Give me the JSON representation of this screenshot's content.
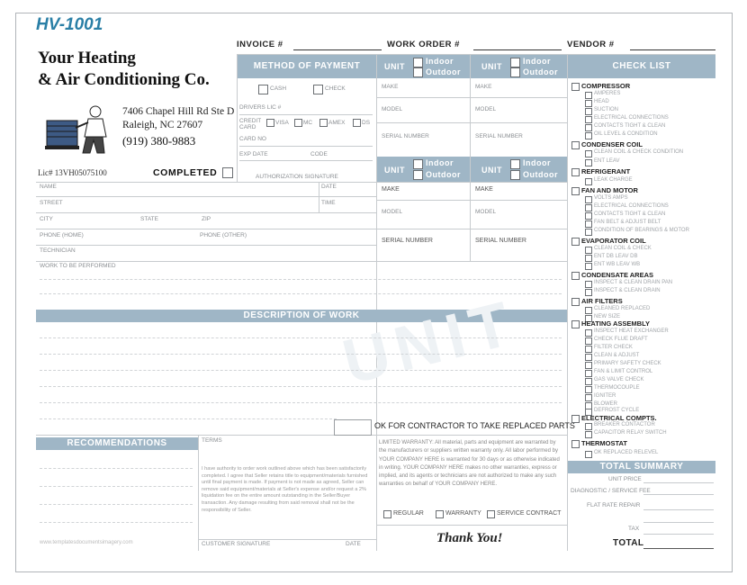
{
  "form_code": "HV-1001",
  "company": {
    "name_line1": "Your Heating",
    "name_line2": "& Air Conditioning Co.",
    "address_line1": "7406 Chapel Hill Rd Ste D",
    "address_line2": "Raleigh, NC 27607",
    "phone": "(919) 380-9883",
    "license": "Lic# 13VH05075100",
    "completed_label": "COMPLETED"
  },
  "top_fields": {
    "invoice": "INVOICE #",
    "work_order": "WORK ORDER #",
    "vendor": "VENDOR #"
  },
  "payment": {
    "header": "METHOD OF PAYMENT",
    "cash": "CASH",
    "check": "CHECK",
    "drivers_lic": "DRIVERS LIC #",
    "credit_card": "CREDIT CARD",
    "visa": "VISA",
    "mc": "MC",
    "amex": "AMEX",
    "ds": "DS",
    "card_no": "CARD NO",
    "exp_date": "EXP DATE",
    "code": "CODE",
    "auth_sig": "AUTHORIZATION SIGNATURE"
  },
  "unit": {
    "label": "UNIT",
    "indoor": "Indoor",
    "outdoor": "Outdoor",
    "make": "MAKE",
    "model": "MODEL",
    "serial": "SERIAL NUMBER"
  },
  "customer": {
    "name": "NAME",
    "date": "DATE",
    "street": "STREET",
    "time": "TIME",
    "city": "CITY",
    "state": "STATE",
    "zip": "ZIP",
    "phone_home": "PHONE (HOME)",
    "phone_other": "PHONE (OTHER)",
    "technician": "TECHNICIAN",
    "work_to_perform": "WORK TO BE PERFORMED"
  },
  "description_header": "DESCRIPTION OF WORK",
  "ok_contractor": "OK FOR CONTRACTOR TO TAKE REPLACED PARTS",
  "recommendations_header": "RECOMMENDATIONS",
  "terms": {
    "title": "TERMS",
    "body": "I have authority to order work outlined above which has been satisfactorily completed. I agree that Seller retains title to equipment/materials furnished until final payment is made. If payment is not made as agreed, Seller can remove said equipment/materials at Seller's expense and/or request a 2% liquidation fee on the entire amount outstanding in the Seller/Buyer transaction. Any damage resulting from said removal shall not be the responsibility of Seller.",
    "customer_sig": "CUSTOMER SIGNATURE",
    "date": "DATE"
  },
  "warranty": {
    "body": "LIMITED WARRANTY: All material, parts and equipment are warranted by the manufacturers or suppliers written warranty only. All labor performed by YOUR COMPANY HERE is warranted for 30 days or as otherwise indicated in writing. YOUR COMPANY HERE makes no other warranties, express or implied, and its agents or technicians are not authorized to make any such warranties on behalf of YOUR COMPANY HERE.",
    "regular": "REGULAR",
    "warranty": "WARRANTY",
    "service_contract": "SERVICE CONTRACT",
    "thank_you": "Thank You!"
  },
  "checklist": {
    "header": "CHECK LIST",
    "sections": [
      {
        "title": "COMPRESSOR",
        "items": [
          "AMPERES",
          "HEAD",
          "SUCTION",
          "ELECTRICAL CONNECTIONS",
          "CONTACTS TIGHT & CLEAN",
          "OIL LEVEL & CONDITION"
        ]
      },
      {
        "title": "CONDENSER COIL",
        "items": [
          "CLEAN COIL & CHECK CONDITION",
          "ENT    LEAV"
        ]
      },
      {
        "title": "REFRIGERANT",
        "items": [
          "LEAK    CHARGE"
        ]
      },
      {
        "title": "FAN AND MOTOR",
        "items": [
          "VOLTS    AMPS",
          "ELECTRICAL CONNECTIONS",
          "CONTACTS TIGHT & CLEAN",
          "FAN BELT & ADJUST BELT",
          "CONDITION OF BEARINGS & MOTOR"
        ]
      },
      {
        "title": "EVAPORATOR COIL",
        "items": [
          "CLEAN COIL & CHECK",
          "ENT DB    LEAV DB",
          "ENT WB    LEAV WB"
        ]
      },
      {
        "title": "CONDENSATE AREAS",
        "items": [
          "INSPECT & CLEAN DRAIN PAN",
          "INSPECT & CLEAN DRAIN"
        ]
      },
      {
        "title": "AIR FILTERS",
        "items": [
          "CLEANED    REPLACED",
          "NEW SIZE"
        ]
      },
      {
        "title": "HEATING ASSEMBLY",
        "items": [
          "INSPECT HEAT EXCHANGER",
          "CHECK FLUE DRAFT",
          "FILTER CHECK",
          "CLEAN & ADJUST",
          "PRIMARY SAFETY CHECK",
          "FAN & LIMIT CONTROL",
          "GAS VALVE CHECK",
          "THERMOCOUPLE",
          "IGNITER",
          "BLOWER",
          "DEFROST CYCLE"
        ]
      },
      {
        "title": "ELECTRICAL COMPTS.",
        "items": [
          "BREAKER    CONTACTOR",
          "CAPACITOR    RELAY SWITCH"
        ]
      },
      {
        "title": "THERMOSTAT",
        "items": [
          "OK    REPLACED    RELEVEL"
        ]
      }
    ]
  },
  "totals": {
    "header": "TOTAL SUMMARY",
    "unit_price": "UNIT PRICE",
    "diagnostic_fee": "DIAGNOSTIC / SERVICE FEE",
    "flat_rate": "FLAT RATE REPAIR",
    "tax": "TAX",
    "total": "TOTAL"
  },
  "watermark": "UNIT",
  "footer_url": "www.templatesdocumentsimagery.com",
  "colors": {
    "header_bg": "#9fb6c6",
    "title": "#2a7fa6",
    "line": "#c7cbce"
  }
}
